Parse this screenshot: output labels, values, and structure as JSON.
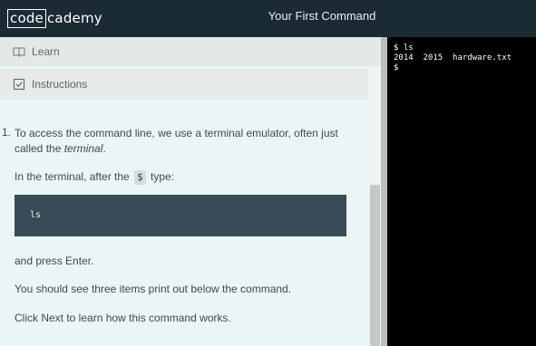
{
  "header": {
    "logo_boxed": "code",
    "logo_rest": "cademy",
    "lesson_title": "Your First Command"
  },
  "nav": {
    "learn_label": "Learn",
    "learn_icon": "book-icon",
    "instructions_label": "Instructions",
    "instructions_icon": "checkbox-icon"
  },
  "instructions": {
    "step_number": "1.",
    "p1_before": "To access the command line, we use a terminal emulator, often just called the ",
    "p1_em": "terminal",
    "p1_after": ".",
    "p2_before": "In the terminal, after the",
    "p2_code": "$",
    "p2_after": "type:",
    "code_block": "ls",
    "p3": "and press Enter.",
    "p4": "You should see three items print out below the command.",
    "p5": "Click Next to learn how this command works."
  },
  "terminal": {
    "lines": [
      "$ ls",
      "2014  2015  hardware.txt",
      "$"
    ]
  },
  "colors": {
    "header_bg": "#1b2b34",
    "panel_bg": "#eaf6f5",
    "code_bg": "#394b57",
    "terminal_bg": "#000000"
  }
}
